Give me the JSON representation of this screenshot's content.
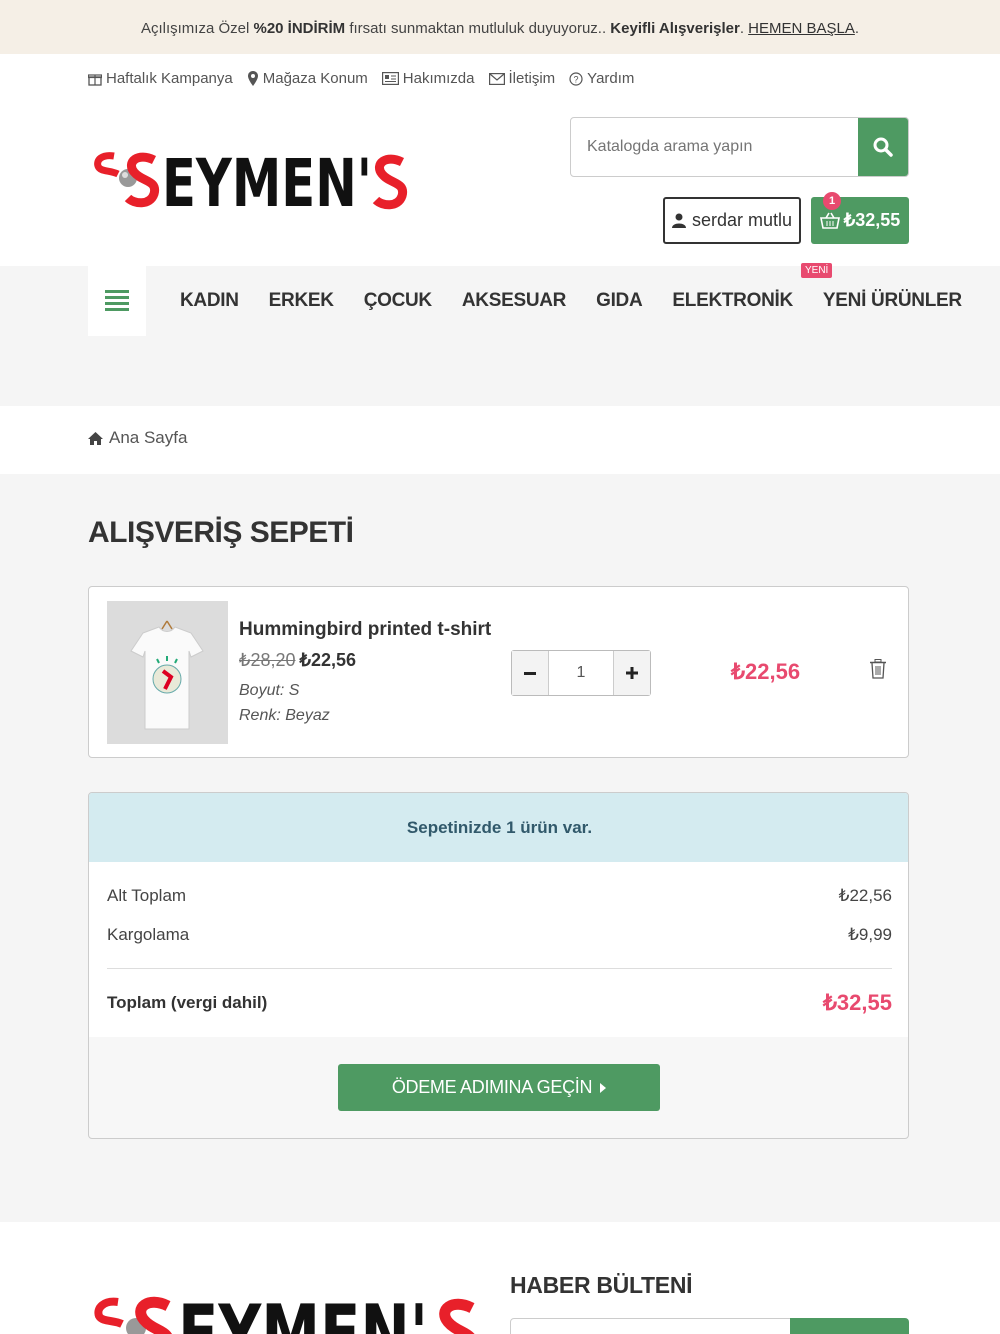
{
  "announcement": {
    "pre": "Açılışımıza Özel ",
    "bold1": "%20 İNDİRİM",
    "mid": " fırsatı sunmaktan mutluluk duyuyoruz.. ",
    "bold2": "Keyifli Alışverişler",
    "dot": ". ",
    "link": "HEMEN BAŞLA",
    "end": "."
  },
  "toplinks": [
    {
      "label": "Haftalık Kampanya",
      "icon": "gift-icon"
    },
    {
      "label": "Mağaza Konum",
      "icon": "map-marker-icon"
    },
    {
      "label": "Hakımızda",
      "icon": "id-card-icon"
    },
    {
      "label": "İletişim",
      "icon": "envelope-icon"
    },
    {
      "label": "Yardım",
      "icon": "question-circle-icon"
    }
  ],
  "logo_text": "SEYMEN'S",
  "search": {
    "placeholder": "Katalogda arama yapın"
  },
  "user": {
    "name": "serdar mutlu"
  },
  "cart": {
    "count": "1",
    "total": "₺32,55"
  },
  "nav": {
    "items": [
      "KADIN",
      "ERKEK",
      "ÇOCUK",
      "AKSESUAR",
      "GIDA",
      "ELEKTRONİK",
      "YENİ ÜRÜNLER"
    ],
    "new_badge": "YENİ"
  },
  "breadcrumb": {
    "home": "Ana Sayfa"
  },
  "page_title": "ALIŞVERİŞ SEPETİ",
  "item": {
    "name": "Hummingbird printed t-shirt",
    "old_price": "₺28,20",
    "price": "₺22,56",
    "size": "Boyut: S",
    "color": "Renk: Beyaz",
    "qty": "1",
    "line_total": "₺22,56"
  },
  "summary": {
    "header": "Sepetinizde 1 ürün var.",
    "subtotal_label": "Alt Toplam",
    "subtotal": "₺22,56",
    "shipping_label": "Kargolama",
    "shipping": "₺9,99",
    "total_label": "Toplam (vergi dahil)",
    "total": "₺32,55",
    "checkout": "ÖDEME ADIMINA GEÇİN"
  },
  "footer": {
    "newsletter_title": "HABER BÜLTENİ"
  },
  "colors": {
    "accent": "#4e9a62",
    "price": "#e84a6f",
    "info": "#d4ebf0"
  }
}
